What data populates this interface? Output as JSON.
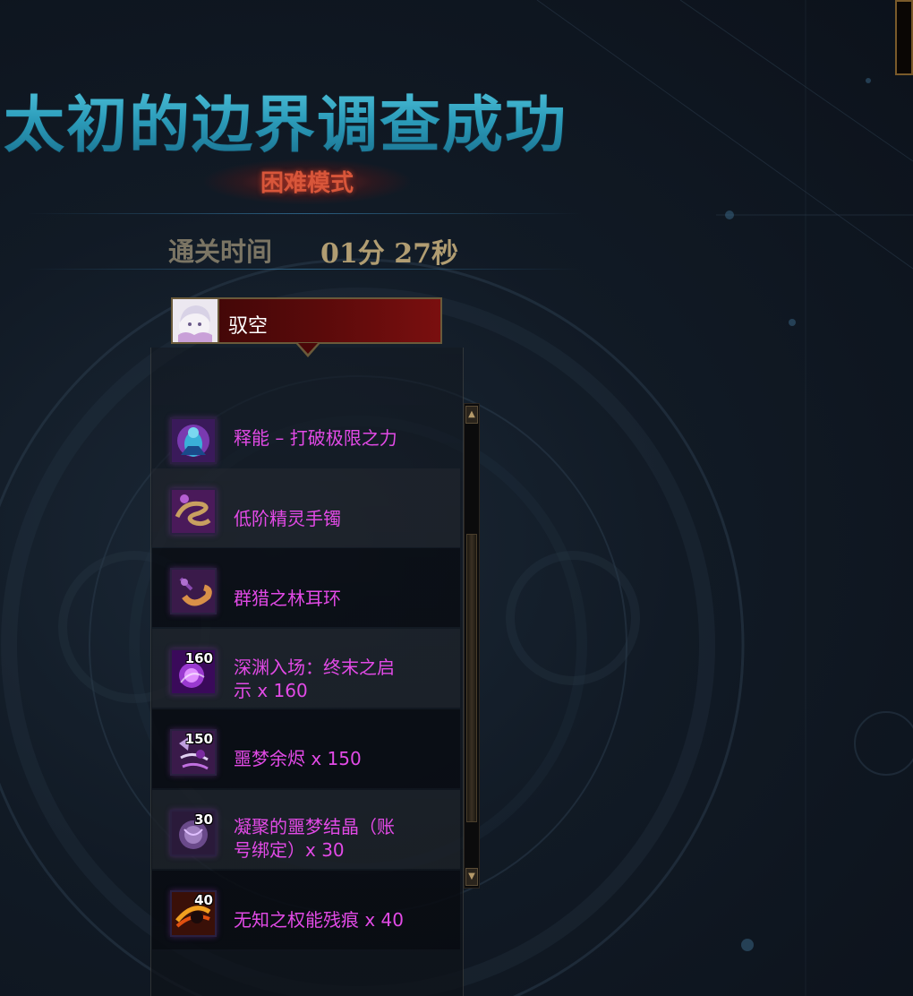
{
  "result": {
    "title": "太初的边界调查成功",
    "mode": "困难模式",
    "clear_time_label": "通关时间",
    "clear_time_value": "01分 27秒"
  },
  "player": {
    "name": "驭空",
    "avatar_icon": "character-portrait-icon"
  },
  "rewards": [
    {
      "name_line1": "释能 – 打破极限之力",
      "name_line2": "",
      "count": "",
      "icon": "energy-release-icon",
      "color": "#e24ae6"
    },
    {
      "name_line1": "低阶精灵手镯",
      "name_line2": "",
      "count": "",
      "icon": "bracelet-icon",
      "color": "#e24ae6"
    },
    {
      "name_line1": "群猎之林耳环",
      "name_line2": "",
      "count": "",
      "icon": "earring-icon",
      "color": "#e24ae6"
    },
    {
      "name_line1": "深渊入场：终末之启",
      "name_line2": "示 x 160",
      "count": "160",
      "icon": "abyss-ticket-icon",
      "color": "#e24ae6"
    },
    {
      "name_line1": "噩梦余烬 x 150",
      "name_line2": "",
      "count": "150",
      "icon": "nightmare-ember-icon",
      "color": "#e24ae6"
    },
    {
      "name_line1": "凝聚的噩梦结晶（账",
      "name_line2": "号绑定）x 30",
      "count": "30",
      "icon": "nightmare-crystal-icon",
      "color": "#e24ae6"
    },
    {
      "name_line1": "无知之权能残痕 x 40",
      "name_line2": "",
      "count": "40",
      "icon": "power-trace-icon",
      "color": "#e24ae6"
    }
  ],
  "colors": {
    "title": "#2aa4bf",
    "mode": "#d8563a",
    "item_name": "#e24ae6",
    "time_value": "#b19d72"
  }
}
